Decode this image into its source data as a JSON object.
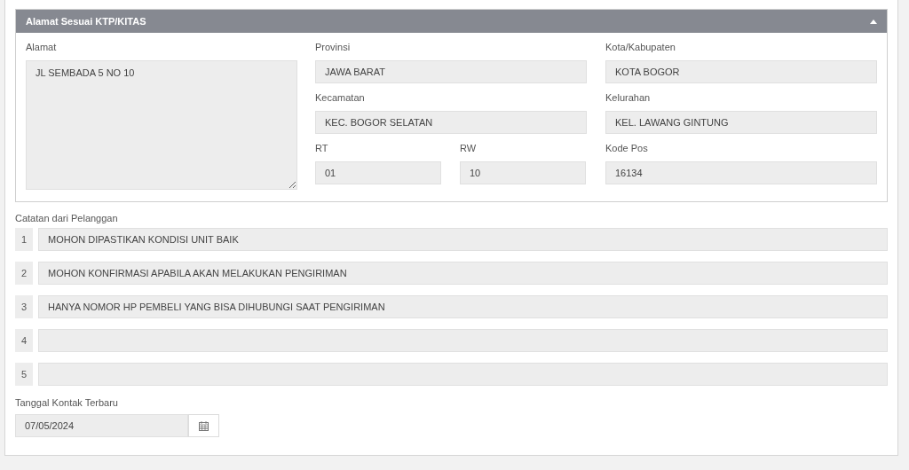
{
  "address_panel": {
    "title": "Alamat Sesuai KTP/KITAS",
    "expanded": true,
    "alamat": {
      "label": "Alamat",
      "value": "JL SEMBADA 5 NO 10"
    },
    "provinsi": {
      "label": "Provinsi",
      "value": "JAWA BARAT"
    },
    "kota": {
      "label": "Kota/Kabupaten",
      "value": "KOTA BOGOR"
    },
    "kecamatan": {
      "label": "Kecamatan",
      "value": "KEC. BOGOR SELATAN"
    },
    "kelurahan": {
      "label": "Kelurahan",
      "value": "KEL. LAWANG GINTUNG"
    },
    "rt": {
      "label": "RT",
      "value": "01"
    },
    "rw": {
      "label": "RW",
      "value": "10"
    },
    "kode_pos": {
      "label": "Kode Pos",
      "value": "16134"
    }
  },
  "notes": {
    "label": "Catatan dari Pelanggan",
    "items": [
      {
        "number": "1",
        "value": "MOHON DIPASTIKAN KONDISI UNIT BAIK"
      },
      {
        "number": "2",
        "value": "MOHON KONFIRMASI APABILA AKAN MELAKUKAN PENGIRIMAN"
      },
      {
        "number": "3",
        "value": "HANYA NOMOR HP PEMBELI YANG BISA DIHUBUNGI SAAT PENGIRIMAN"
      },
      {
        "number": "4"
      },
      {
        "number": "5"
      }
    ]
  },
  "last_contact": {
    "label": "Tanggal Kontak Terbaru",
    "value": "07/05/2024"
  }
}
